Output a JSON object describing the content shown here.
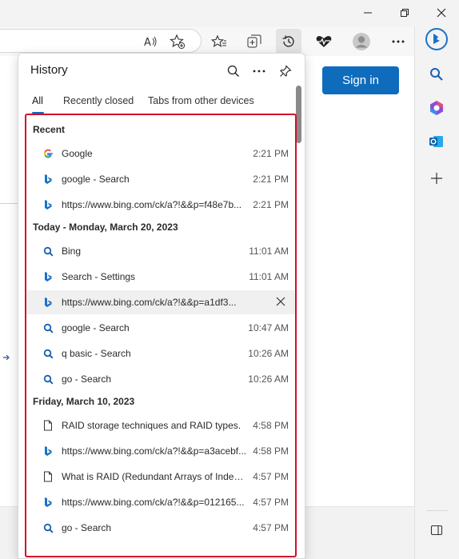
{
  "window": {
    "minimize": "—",
    "maximize": "❐",
    "close": "✕"
  },
  "page": {
    "signin_label": "Sign in"
  },
  "history": {
    "title": "History",
    "tabs": [
      "All",
      "Recently closed",
      "Tabs from other devices"
    ],
    "sections": [
      {
        "heading": "Recent",
        "items": [
          {
            "icon": "google-icon",
            "title": "Google",
            "time": "2:21 PM"
          },
          {
            "icon": "bing-icon",
            "title": "google - Search",
            "time": "2:21 PM"
          },
          {
            "icon": "bing-icon",
            "title": "https://www.bing.com/ck/a?!&&p=f48e7b...",
            "time": "2:21 PM"
          }
        ]
      },
      {
        "heading": "Today - Monday, March 20, 2023",
        "items": [
          {
            "icon": "search-icon",
            "title": "Bing",
            "time": "11:01 AM"
          },
          {
            "icon": "bing-icon",
            "title": "Search - Settings",
            "time": "11:01 AM"
          },
          {
            "icon": "bing-icon",
            "title": "https://www.bing.com/ck/a?!&&p=a1df3...",
            "time": "",
            "hover": true
          },
          {
            "icon": "search-icon",
            "title": "google - Search",
            "time": "10:47 AM"
          },
          {
            "icon": "search-icon",
            "title": "q basic - Search",
            "time": "10:26 AM"
          },
          {
            "icon": "search-icon",
            "title": "go - Search",
            "time": "10:26 AM"
          }
        ]
      },
      {
        "heading": "Friday, March 10, 2023",
        "items": [
          {
            "icon": "document-icon",
            "title": "RAID storage techniques and RAID types.",
            "time": "4:58 PM"
          },
          {
            "icon": "bing-icon",
            "title": "https://www.bing.com/ck/a?!&&p=a3acebf...",
            "time": "4:58 PM"
          },
          {
            "icon": "document-icon",
            "title": "What is RAID (Redundant Arrays of Indepe...",
            "time": "4:57 PM"
          },
          {
            "icon": "bing-icon",
            "title": "https://www.bing.com/ck/a?!&&p=012165...",
            "time": "4:57 PM"
          },
          {
            "icon": "search-icon",
            "title": "go - Search",
            "time": "4:57 PM"
          }
        ]
      }
    ]
  },
  "colors": {
    "accent": "#0f6cbd",
    "highlight_border": "#d0102a",
    "bing": "#1a73c8"
  }
}
